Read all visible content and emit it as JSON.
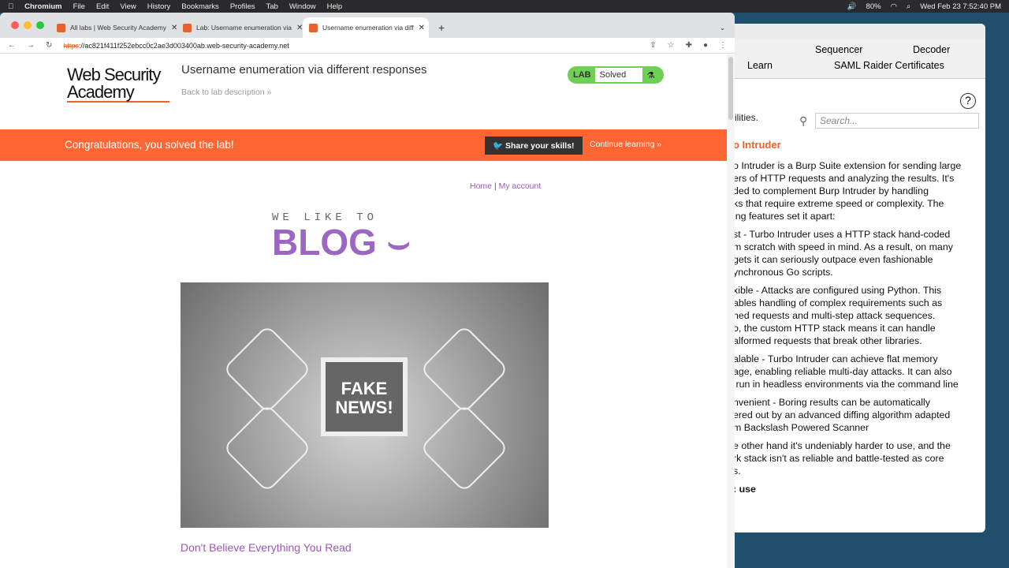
{
  "menubar": {
    "app": "Chromium",
    "items": [
      "File",
      "Edit",
      "View",
      "History",
      "Bookmarks",
      "Profiles",
      "Tab",
      "Window",
      "Help"
    ],
    "battery": "80%",
    "clock": "Wed Feb 23  7:52:40 PM"
  },
  "browser": {
    "tabs": [
      {
        "label": "All labs | Web Security Academy"
      },
      {
        "label": "Lab: Username enumeration via"
      },
      {
        "label": "Username enumeration via diff"
      }
    ],
    "url_scheme": "https",
    "url_rest": "://ac821f411f252ebcc0c2ae3d003400ab.web-security-academy.net"
  },
  "lab": {
    "logo": "Web Security Academy",
    "title": "Username enumeration via different responses",
    "back": "Back to lab description »",
    "badge_label": "LAB",
    "badge_status": "Solved",
    "banner": "Congratulations, you solved the lab!",
    "share": "Share your skills!",
    "continue": "Continue learning »"
  },
  "blog": {
    "nav_home": "Home",
    "nav_sep": "|",
    "nav_account": "My account",
    "we_like_to": "WE LIKE TO",
    "blog": "BLOG",
    "image_text": "FAKE NEWS!",
    "post_title": "Don't Believe Everything You Read"
  },
  "burp": {
    "tab_sequencer": "Sequencer",
    "tab_decoder": "Decoder",
    "tab_learn": "Learn",
    "tab_saml": "SAML Raider Certificates",
    "ities": "ilities.",
    "search_placeholder": "Search...",
    "heading": "o Intruder",
    "paragraphs": [
      "o Intruder is a Burp Suite extension for sending large\ners of HTTP requests and analyzing the results. It's\nded to complement Burp Intruder by handling\nks that require extreme speed or complexity. The\ning features set it apart:",
      "st - Turbo Intruder uses a HTTP stack hand-coded\nm scratch with speed in mind. As a result, on many\ngets it can seriously outpace even fashionable\nynchronous Go scripts.",
      "xible - Attacks are configured using Python. This\nables handling of complex requirements such as\nned requests and multi-step attack sequences.\no, the custom HTTP stack means it can handle\nalformed requests that break other libraries.",
      "alable - Turbo Intruder can achieve flat memory\nage, enabling reliable multi-day attacks. It can also\n run in headless environments via the command line",
      "nvenient - Boring results can be automatically\nered out by an advanced diffing algorithm adapted\nm Backslash Powered Scanner",
      "e other hand it's undeniably harder to use, and the\nrk stack isn't as reliable and battle-tested as core\ns."
    ],
    "subheading": ": use"
  },
  "colors": {
    "accent": "#ff6633",
    "blog_purple": "#9b66c4",
    "lab_green": "#70d054"
  }
}
